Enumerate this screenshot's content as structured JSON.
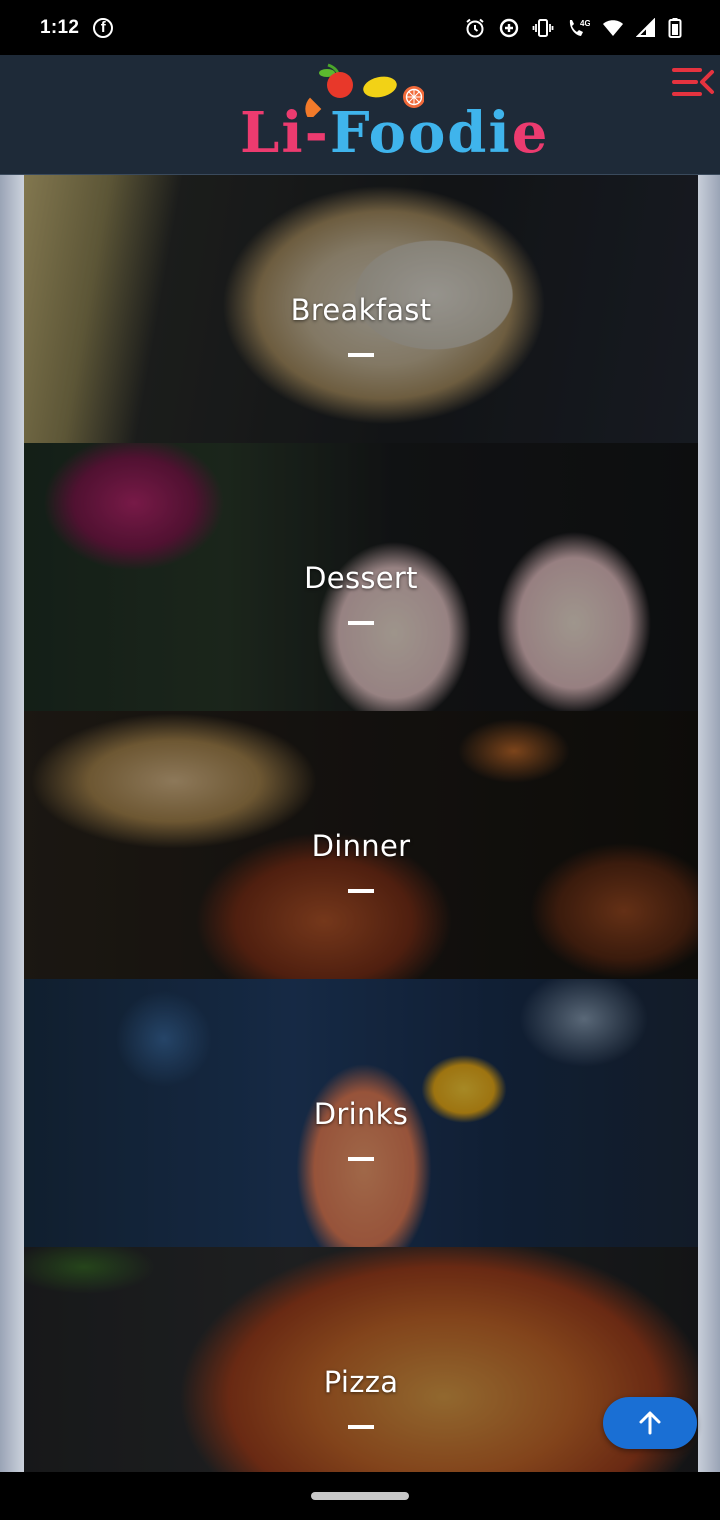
{
  "status_bar": {
    "time": "1:12",
    "notification_icons": [
      "facebook-icon"
    ],
    "system_icons": [
      "alarm-icon",
      "data-saver-icon",
      "vibrate-icon",
      "volte-call-icon",
      "wifi-icon",
      "signal-icon",
      "battery-icon"
    ],
    "network_label": "4G"
  },
  "header": {
    "logo_left": "Li-",
    "logo_right": "Foodi",
    "logo_end": "e",
    "menu_icon": "menu-collapse-icon"
  },
  "categories": [
    {
      "label": "Breakfast"
    },
    {
      "label": "Dessert"
    },
    {
      "label": "Dinner"
    },
    {
      "label": "Drinks"
    },
    {
      "label": "Pizza"
    }
  ],
  "fab": {
    "icon": "arrow-up-icon"
  },
  "colors": {
    "header_bg": "#1e2a38",
    "logo_pink": "#ec3b6f",
    "logo_blue": "#3fb4ec",
    "menu_red": "#e5333f",
    "fab_blue": "#1a6fd4"
  }
}
